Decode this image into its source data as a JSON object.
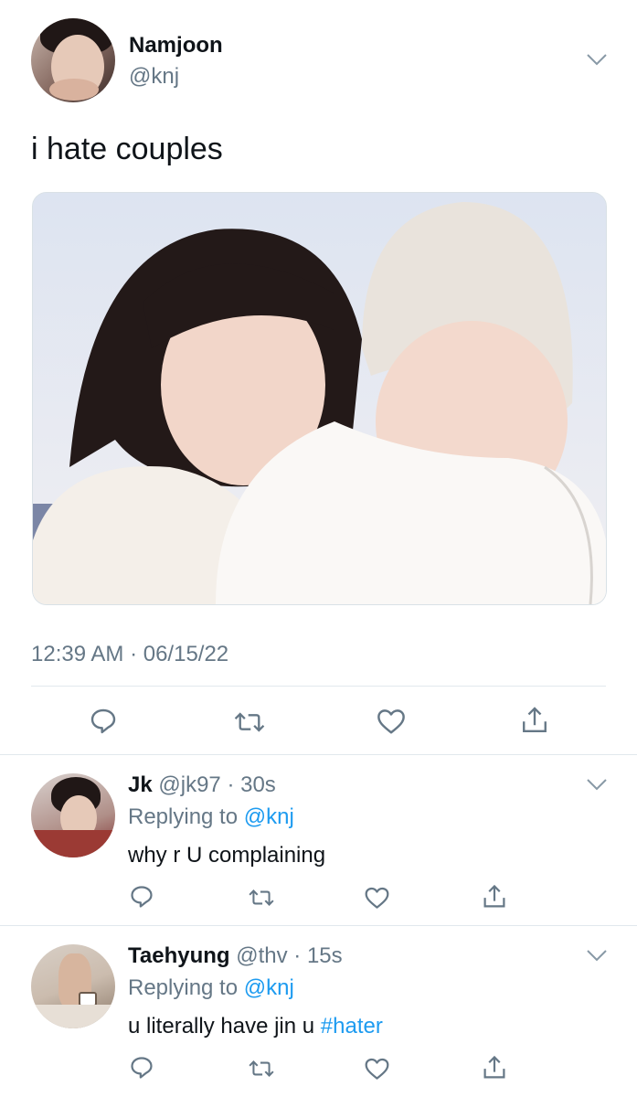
{
  "tweet": {
    "name": "Namjoon",
    "handle": "@knj",
    "text": "i hate couples",
    "timestamp": "12:39 AM · 06/15/22"
  },
  "replies": [
    {
      "name": "Jk",
      "handle": "@jk97",
      "time": "· 30s",
      "replying_prefix": "Replying to ",
      "replying_to": "@knj",
      "text": "why r U complaining",
      "hashtag": ""
    },
    {
      "name": "Taehyung",
      "handle": "@thv",
      "time": "· 15s",
      "replying_prefix": "Replying to ",
      "replying_to": "@knj",
      "text": "u literally have jin u ",
      "hashtag": "#hater"
    }
  ],
  "icons": {
    "reply": "reply-icon",
    "retweet": "retweet-icon",
    "like": "heart-icon",
    "share": "share-icon",
    "more": "chevron-down-icon"
  },
  "colors": {
    "link": "#1d9bf0",
    "muted": "#657786",
    "divider": "#e1e8ed"
  }
}
